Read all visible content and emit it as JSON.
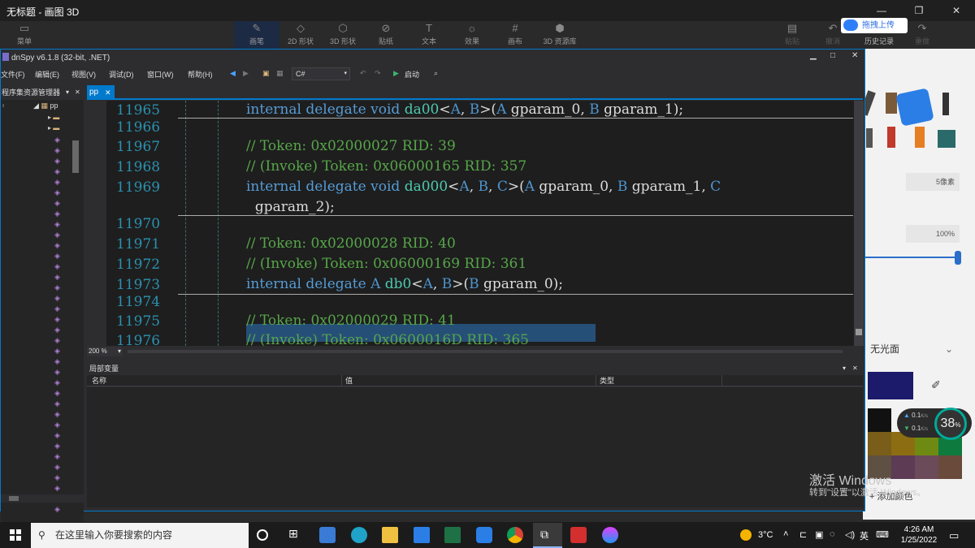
{
  "paint3d": {
    "window_title": "无标题 - 画图 3D",
    "menu_label": "菜单",
    "tools": [
      "画笔",
      "2D 形状",
      "3D 形状",
      "贴纸",
      "文本",
      "效果",
      "画布",
      "3D 资源库"
    ],
    "right_tools": [
      "粘贴",
      "撤消",
      "历史记录",
      "重做"
    ],
    "upload_label": "拖拽上传",
    "thickness": "5像素",
    "opacity": "100%",
    "finish_label": "无光面",
    "add_color": "添加颜色",
    "colors": {
      "accent": "#007acc",
      "selection": "#264f78",
      "keyword": "#569cd6",
      "comment": "#57a64a",
      "line_number": "#2b91af"
    }
  },
  "dnspy": {
    "title": "dnSpy v6.1.8 (32-bit, .NET)",
    "menu": [
      "文件(F)",
      "编辑(E)",
      "视图(V)",
      "调试(D)",
      "窗口(W)",
      "帮助(H)"
    ],
    "language": "C#",
    "start_label": "启动",
    "explorer_title": "程序集资源管理器",
    "explorer_root": "pp",
    "tab": "pp",
    "zoom": "200 %",
    "locals_title": "局部变量",
    "locals_columns": [
      "名称",
      "值",
      "类型"
    ],
    "code_lines": [
      {
        "n": "11965",
        "text": "internal delegate void da00<A, B>(A gparam_0, B gparam_1);"
      },
      {
        "n": "11966",
        "text": ""
      },
      {
        "n": "11967",
        "text": "// Token: 0x02000027 RID: 39"
      },
      {
        "n": "11968",
        "text": "// (Invoke) Token: 0x06000165 RID: 357"
      },
      {
        "n": "11969",
        "text": "internal delegate void da000<A, B, C>(A gparam_0, B gparam_1, C"
      },
      {
        "n": "",
        "text": "  gparam_2);"
      },
      {
        "n": "11970",
        "text": ""
      },
      {
        "n": "11971",
        "text": "// Token: 0x02000028 RID: 40"
      },
      {
        "n": "11972",
        "text": "// (Invoke) Token: 0x06000169 RID: 361"
      },
      {
        "n": "11973",
        "text": "internal delegate A db0<A, B>(B gparam_0);"
      },
      {
        "n": "11974",
        "text": ""
      },
      {
        "n": "11975",
        "text": "// Token: 0x02000029 RID: 41"
      },
      {
        "n": "11976",
        "text": "// (Invoke) Token: 0x0600016D RID: 365"
      }
    ]
  },
  "overlay": {
    "net_up": "0.1",
    "net_down": "0.1",
    "net_unit": "K/s",
    "percent": "38",
    "activate_title": "激活 Windows",
    "activate_sub": "转到\"设置\"以激活 Windows。"
  },
  "taskbar": {
    "search_placeholder": "在这里输入你要搜索的内容",
    "weather": "3°C",
    "ime": "英",
    "time": "4:26 AM",
    "date": "1/25/2022"
  }
}
